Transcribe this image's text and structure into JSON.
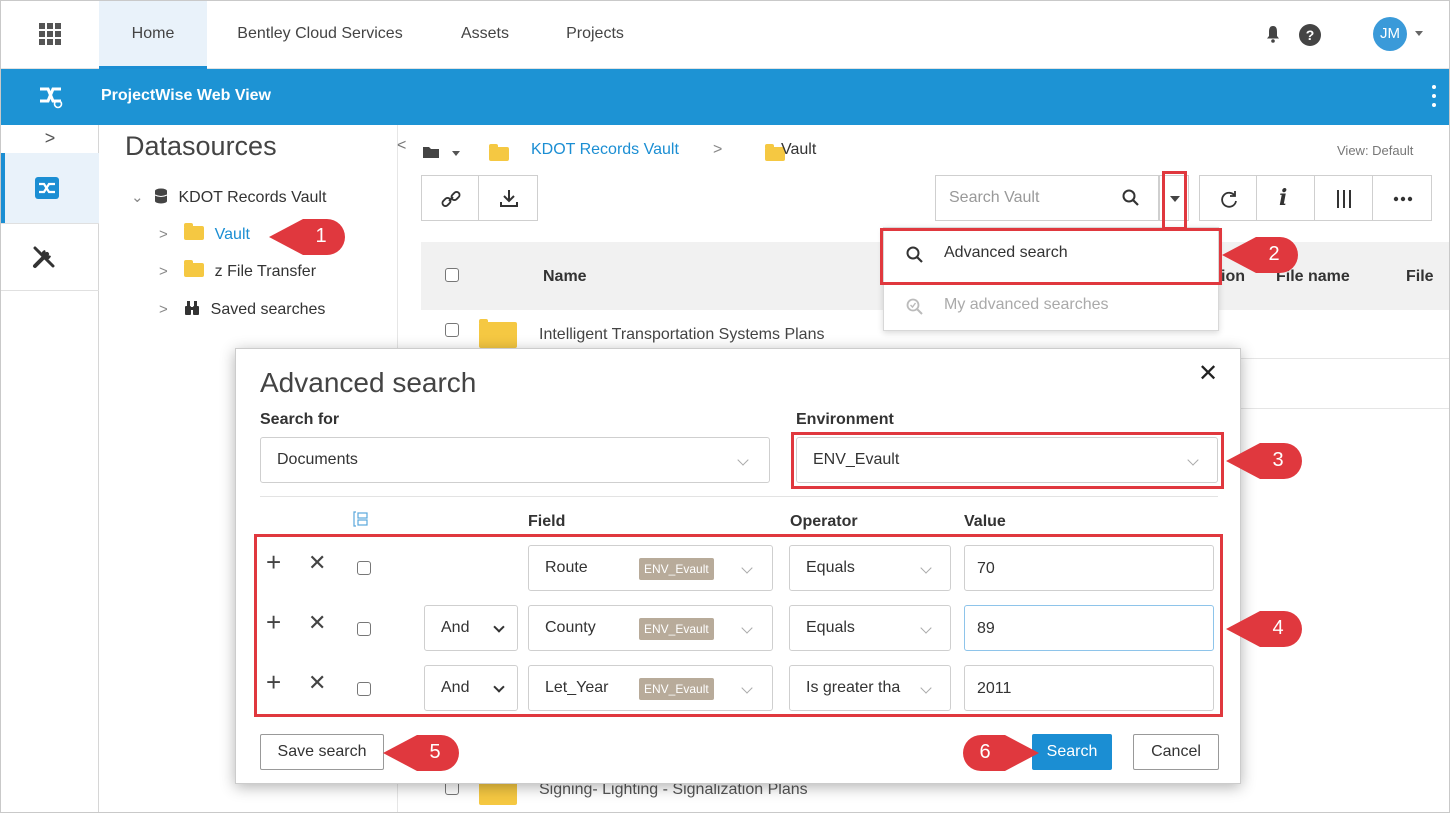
{
  "topnav": {
    "tabs": [
      "Home",
      "Bentley Cloud Services",
      "Assets",
      "Projects"
    ],
    "help": "?",
    "avatar_initials": "JM"
  },
  "app": {
    "name": "ProjectWise Web View"
  },
  "datasources": {
    "title": "Datasources",
    "root": "KDOT Records Vault",
    "children": [
      "Vault",
      "z File Transfer",
      "Saved searches"
    ]
  },
  "breadcrumb": {
    "root": "KDOT Records Vault",
    "sep": ">",
    "current": "Vault"
  },
  "view_label": "View: Default",
  "search": {
    "placeholder": "Search Vault"
  },
  "grid": {
    "columns": [
      "Name",
      "ion",
      "File name",
      "File"
    ],
    "rows": [
      "Intelligent Transportation Systems Plans",
      "Signing- Lighting - Signalization Plans"
    ]
  },
  "menu": {
    "items": [
      "Advanced search",
      "My advanced searches"
    ]
  },
  "modal": {
    "title": "Advanced search",
    "close": "✕",
    "search_for_label": "Search for",
    "search_for_value": "Documents",
    "environment_label": "Environment",
    "environment_value": "ENV_Evault",
    "col_field": "Field",
    "col_operator": "Operator",
    "col_value": "Value",
    "criteria": [
      {
        "logic": "",
        "field": "Route",
        "tag": "ENV_Evault",
        "operator": "Equals",
        "value": "70"
      },
      {
        "logic": "And",
        "field": "County",
        "tag": "ENV_Evault",
        "operator": "Equals",
        "value": "89"
      },
      {
        "logic": "And",
        "field": "Let_Year",
        "tag": "ENV_Evault",
        "operator": "Is greater tha",
        "value": "2011"
      }
    ],
    "save_search": "Save search",
    "search": "Search",
    "cancel": "Cancel"
  },
  "callouts": [
    "1",
    "2",
    "3",
    "4",
    "5",
    "6"
  ],
  "colors": {
    "accent": "#1b8ed3",
    "bluebar": "#1d93d4",
    "callout": "#e0383e",
    "folder": "#f5c842",
    "env_tag": "#b8ab9a"
  }
}
